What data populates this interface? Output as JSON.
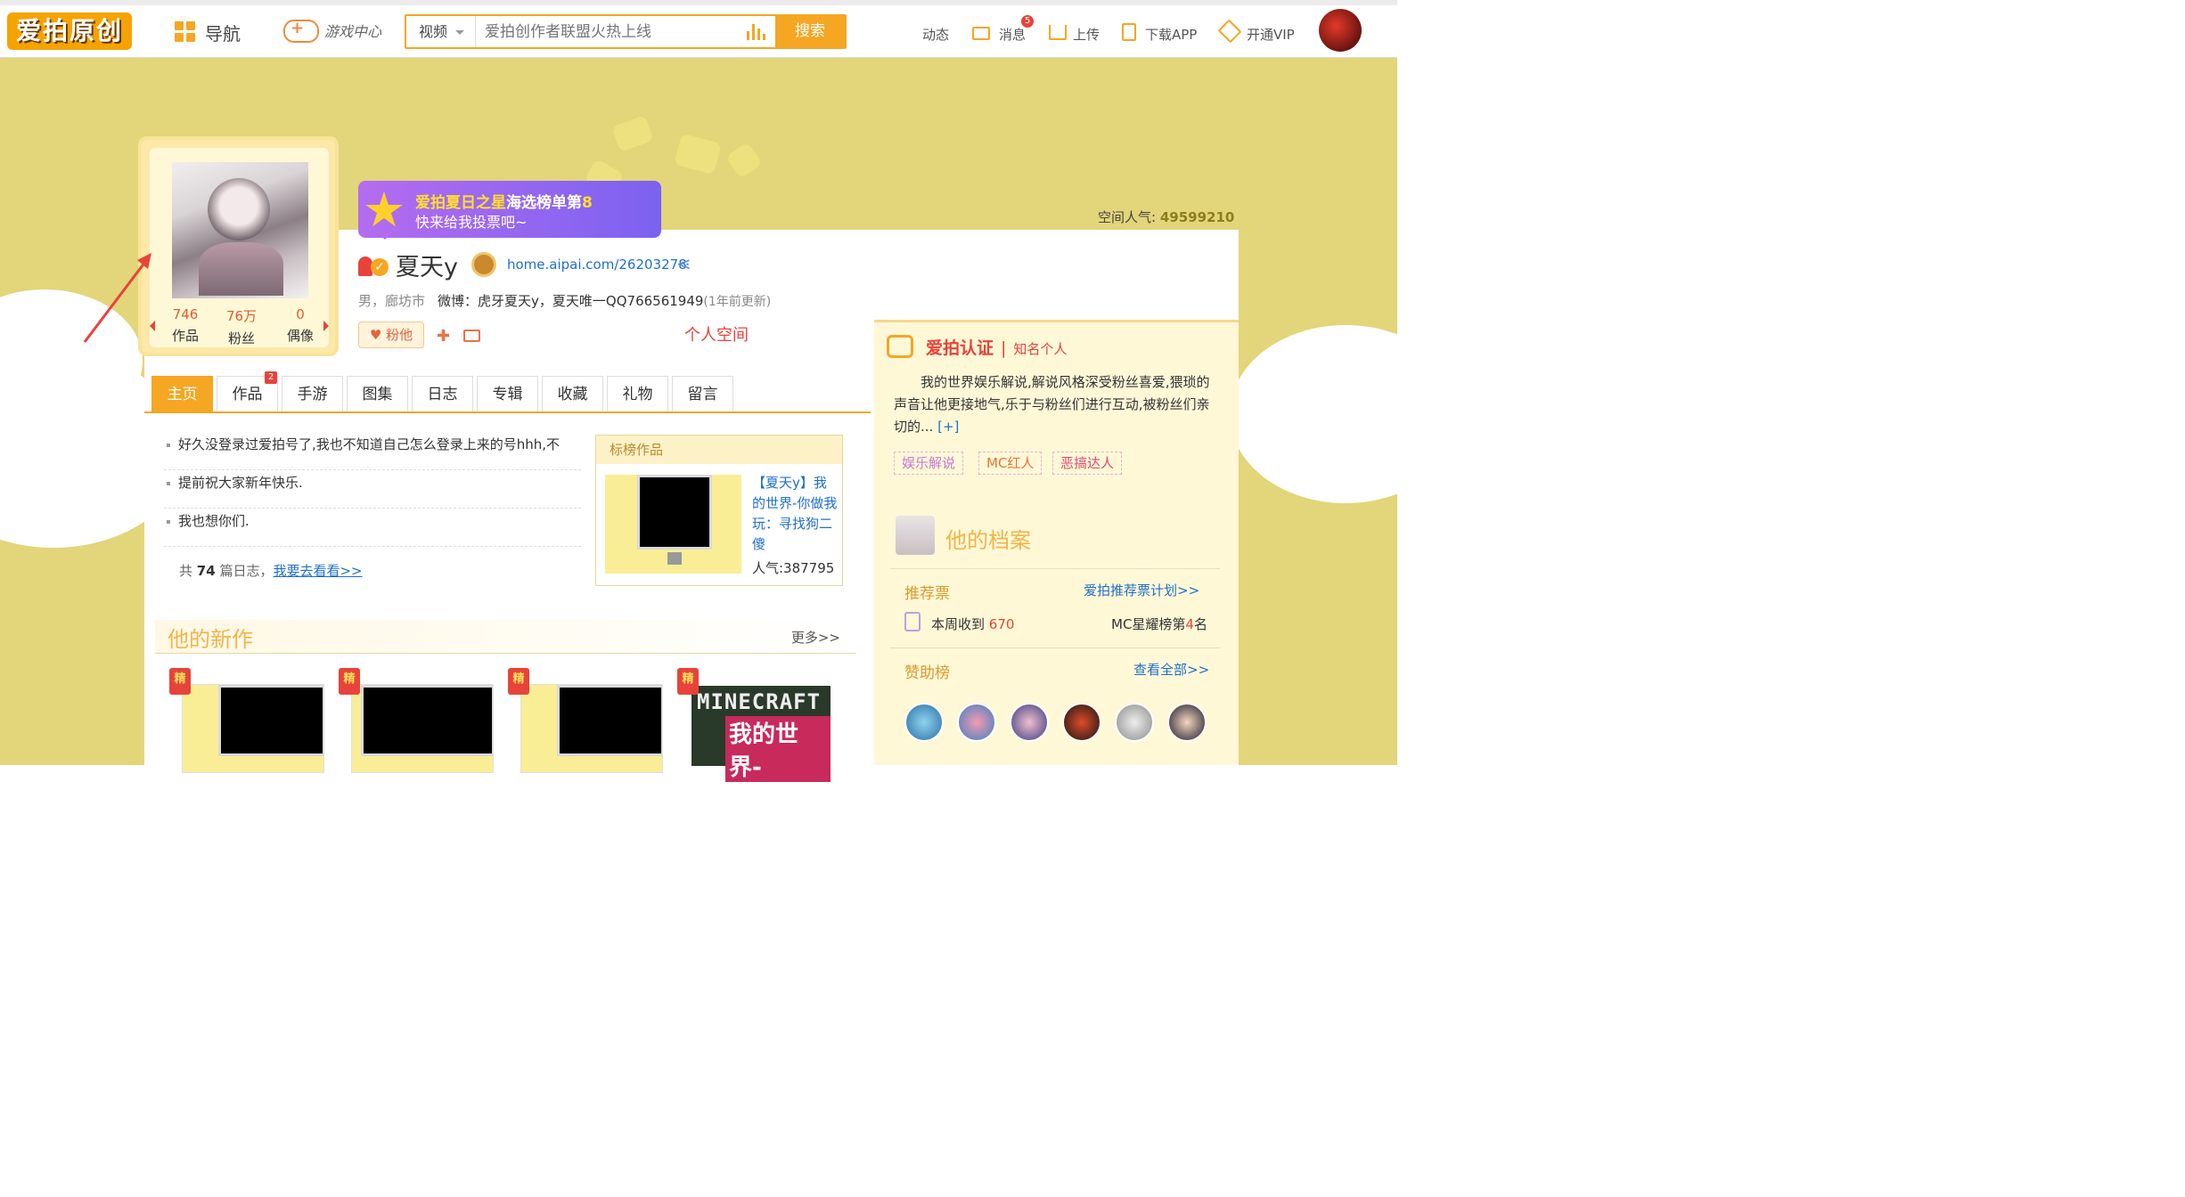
{
  "topbar": {
    "logo": "爱拍原创",
    "nav_label": "导航",
    "game_center": "游戏中心",
    "search_category": "视频",
    "search_placeholder": "爱拍创作者联盟火热上线",
    "search_button": "搜索",
    "links": [
      {
        "label": "动态"
      },
      {
        "label": "消息",
        "badge": "5"
      },
      {
        "label": "上传"
      },
      {
        "label": "下载APP"
      },
      {
        "label": "开通VIP"
      }
    ]
  },
  "space_popularity": {
    "label": "空间人气:",
    "value": "49599210"
  },
  "profile_card": {
    "stats": [
      {
        "value": "746",
        "label": "作品"
      },
      {
        "value": "76万",
        "label": "粉丝"
      },
      {
        "value": "0",
        "label": "偶像"
      }
    ]
  },
  "notice": {
    "line1_hl": "爱拍夏日之星",
    "line1_mid": "海选榜单第",
    "line1_num": "8",
    "line2": "快来给我投票吧~"
  },
  "user": {
    "name": "夏天y",
    "url": "home.aipai.com/26203278",
    "gender_city": "男，廊坊市",
    "weibo_label": "微博：",
    "weibo_text": "虎牙夏天y，夏天唯一QQ766561949",
    "weibo_sub": "(1年前更新)",
    "fan_button": "粉他",
    "annotation": "个人空间"
  },
  "tabs": [
    {
      "label": "主页",
      "active": true
    },
    {
      "label": "作品",
      "badge": "2"
    },
    {
      "label": "手游"
    },
    {
      "label": "图集"
    },
    {
      "label": "日志"
    },
    {
      "label": "专辑"
    },
    {
      "label": "收藏"
    },
    {
      "label": "礼物"
    },
    {
      "label": "留言"
    }
  ],
  "journal": {
    "items": [
      "好久没登录过爱拍号了,我也不知道自己怎么登录上来的号hhh,不",
      "提前祝大家新年快乐.",
      "我也想你们."
    ],
    "count_prefix": "共",
    "count": "74",
    "count_suffix": "篇日志，",
    "link": "我要去看看>>"
  },
  "ranked_work": {
    "header": "标榜作品",
    "title": "【夏天y】我的世界-你做我玩：寻找狗二傻",
    "popularity": "人气:387795"
  },
  "new_works": {
    "title": "他的新作",
    "more": "更多>>",
    "ribbon": "精",
    "mc_line1": "MINECRAFT",
    "mc_line2": "我的世界-"
  },
  "auth": {
    "title": "爱拍认证",
    "sep": "|",
    "level": "知名个人",
    "desc": "我的世界娱乐解说,解说风格深受粉丝喜爱,猥琐的声音让他更接地气,乐于与粉丝们进行互动,被粉丝们亲切的...",
    "more": "[+]",
    "tags": [
      {
        "label": "娱乐解说",
        "color": "#c27bd6"
      },
      {
        "label": "MC红人",
        "color": "#e8733a"
      },
      {
        "label": "恶搞达人",
        "color": "#d94b73"
      }
    ]
  },
  "archive": {
    "title": "他的档案",
    "recommend_title": "推荐票",
    "recommend_link": "爱拍推荐票计划>>",
    "week_label": "本周收到",
    "week_value": "670",
    "rank_prefix": "MC星耀榜第",
    "rank_value": "4",
    "rank_suffix": "名",
    "sponsor_title": "赞助榜",
    "sponsor_link": "查看全部>>"
  },
  "colors": {
    "accent": "#f5a623",
    "banner": "#e3d579",
    "link": "#1f6fcc",
    "alert": "#e8433a"
  }
}
